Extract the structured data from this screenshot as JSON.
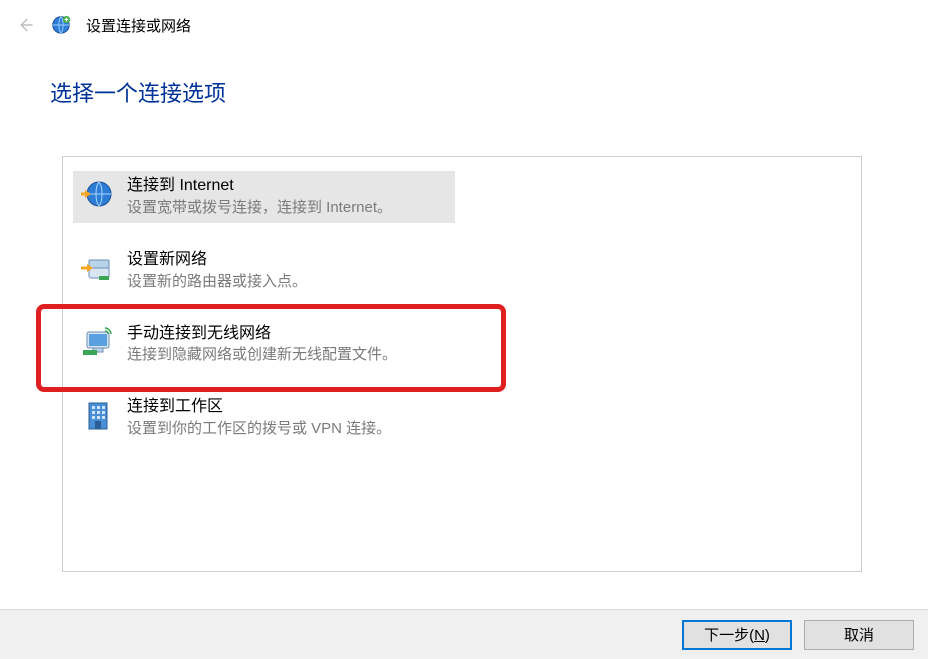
{
  "header": {
    "window_title": "设置连接或网络"
  },
  "heading": "选择一个连接选项",
  "options": [
    {
      "title": "连接到 Internet",
      "desc": "设置宽带或拨号连接，连接到 Internet。"
    },
    {
      "title": "设置新网络",
      "desc": "设置新的路由器或接入点。"
    },
    {
      "title": "手动连接到无线网络",
      "desc": "连接到隐藏网络或创建新无线配置文件。"
    },
    {
      "title": "连接到工作区",
      "desc": "设置到你的工作区的拨号或 VPN 连接。"
    }
  ],
  "buttons": {
    "next_prefix": "下一步(",
    "next_hotkey": "N",
    "next_suffix": ")",
    "cancel": "取消"
  }
}
